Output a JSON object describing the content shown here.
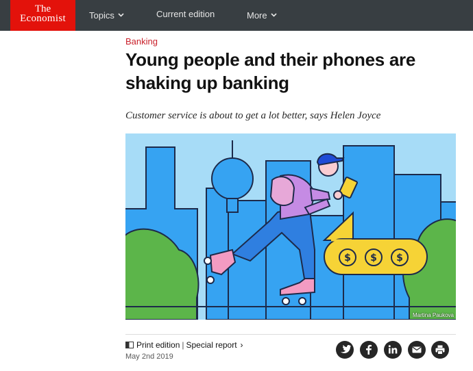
{
  "nav": {
    "logo_line1": "The",
    "logo_line2": "Economist",
    "items": [
      {
        "label": "Topics",
        "has_dropdown": true
      },
      {
        "label": "Current edition",
        "has_dropdown": false
      },
      {
        "label": "More",
        "has_dropdown": true
      }
    ]
  },
  "article": {
    "section": "Banking",
    "headline": "Young people and their phones are shaking up banking",
    "rubric": "Customer service is about to get a lot better, says Helen Joyce",
    "image_credit": "Martina Paukova",
    "edition_label": "Print edition",
    "category_label": "Special report",
    "date": "May 2nd 2019"
  },
  "share": {
    "icons": [
      "twitter-icon",
      "facebook-icon",
      "linkedin-icon",
      "mail-icon",
      "print-icon"
    ]
  },
  "colors": {
    "nav_bg": "#383e42",
    "brand_red": "#e3120b",
    "section_red": "#c9202a",
    "sky_blue": "#a7dcf7",
    "building_blue": "#36a3f2",
    "bush_green": "#5cb54a",
    "bubble_yellow": "#f6d336"
  }
}
